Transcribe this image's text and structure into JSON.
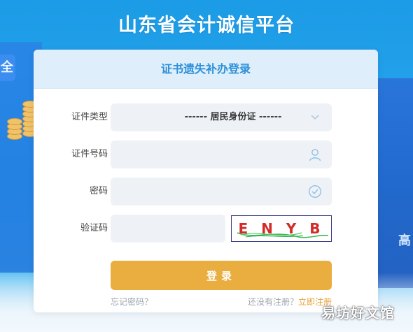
{
  "header": {
    "title": "山东省会计诚信平台"
  },
  "card": {
    "title": "证书遗失补办登录"
  },
  "form": {
    "id_type": {
      "label": "证件类型",
      "value": "------ 居民身份证 ------"
    },
    "id_number": {
      "label": "证件号码",
      "value": "",
      "placeholder": ""
    },
    "password": {
      "label": "密码",
      "value": "",
      "placeholder": ""
    },
    "captcha": {
      "label": "验证码",
      "value": "",
      "placeholder": "",
      "image_text": "E N Y B"
    }
  },
  "actions": {
    "login_label": "登录",
    "forgot_label": "忘记密码？",
    "no_account_label": "还没有注册？",
    "register_label": "立即注册"
  },
  "background": {
    "left_char": "全",
    "right_char": "高"
  },
  "watermark": {
    "text": "易坊好文馆"
  },
  "colors": {
    "primary": "#2c8fd8",
    "header_bg": "#deeffb",
    "button": "#e9ae3f",
    "link": "#e8a23a",
    "field_bg": "#eef2f7"
  },
  "icons": {
    "chevron": "chevron-down-icon",
    "user": "user-icon",
    "check": "check-circle-icon"
  }
}
